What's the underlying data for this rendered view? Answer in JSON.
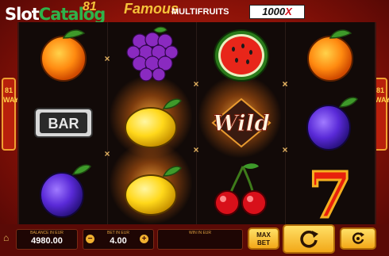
{
  "watermark": {
    "part1": "Slot",
    "part2": "Catalog"
  },
  "title": {
    "number": "81",
    "word": "Famous",
    "multifruits": "MULTIFRUITS",
    "multiplier": "1000",
    "multiplier_suffix": "X"
  },
  "side_badges": {
    "left": [
      "81",
      "WAYS"
    ],
    "right": [
      "81",
      "WAYS"
    ]
  },
  "reels": [
    [
      "orange",
      "bar",
      "plum"
    ],
    [
      "grapes",
      "lemon",
      "lemon"
    ],
    [
      "watermelon",
      "wild",
      "cherries"
    ],
    [
      "orange",
      "plum",
      "seven"
    ]
  ],
  "symbols": {
    "bar_label": "BAR",
    "wild_label": "Wild",
    "seven_label": "7"
  },
  "footer": {
    "balance": {
      "label": "BALANCE IN EUR",
      "value": "4980.00"
    },
    "bet": {
      "label": "BET IN EUR",
      "value": "4.00",
      "minus": "−",
      "plus": "+"
    },
    "win": {
      "label": "WIN IN EUR",
      "value": ""
    },
    "max_bet": {
      "line1": "MAX",
      "line2": "BET"
    },
    "spin_icon": "refresh-icon",
    "autoplay_icon": "autoplay-icon"
  },
  "colors": {
    "accent": "#f5c23a",
    "background": "#8c1208",
    "button": "#f2a818"
  }
}
